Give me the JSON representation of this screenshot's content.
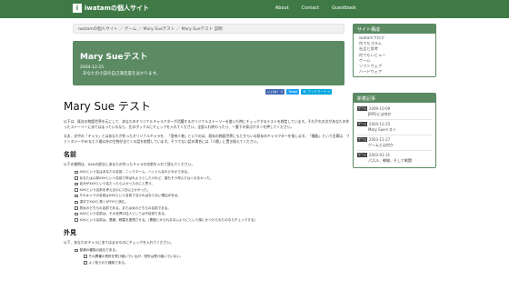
{
  "nav": {
    "logo_char": "i",
    "brand": "iwatamの個人サイト",
    "links": [
      "About",
      "Contact",
      "Guestbook"
    ]
  },
  "breadcrumb": "iwatamの個人サイト ／ ゲーム ／ Mary Sueテスト ／ Mary Sueテスト 説明",
  "hero": {
    "title": "Mary Sueテスト",
    "date": "2004-12-25",
    "subtitle": "あなたの小説の自己満足度をはかります。"
  },
  "share": {
    "like": "いいね！ 0",
    "tweet": "Tweet",
    "bookmark": "B! ブックマーク 0"
  },
  "article": {
    "title": "Mary Sue テスト",
    "p1": "以下は、既存の物語世界を元にして、あなたのオリジナルキャラクターが活躍するオリジナルストーリーを書いた時にチェックするテストを想定しています。それぞれの文があなたの作ったストーリーにあてはまっているなら、左のボックスにチェックを入れてください。全部入れ終わったら、一番下の採点ボタンを押してください。",
    "p2": "なお、文中の「キャラ」とはあなたが作ったオリジナルキャラを、「皇帝人物」というのは、既存の物語世界にもとからいる既存のキャラクターを指します。「種族」という言葉は、ファンタジーやSFなど人間以外の生物が出てくる話を前提しています。そうでない話の場合には「人間」に置き換えてください。",
    "sections": [
      {
        "heading": "名前",
        "intro": "以下の質問は、XXXの部分にあなたの作ったキャラの名前を入れて読んでください。",
        "items": [
          {
            "text": "XXXという名はあなたの名前、ニックネーム、ハンドル名のどれかである。",
            "sub": false
          },
          {
            "text": "あなたは以前XXXという名前で呼ばれようとしたけれど、誰もそう呼んではくれなかった。",
            "sub": false
          },
          {
            "text": "自分がXXXという名だったらよかったのにと思う。",
            "sub": false
          },
          {
            "text": "XXXという名前を考えるのに1日以上かかった。",
            "sub": false
          },
          {
            "text": "そのキャラの名前はXXXという名前でなければならない理由がある。",
            "sub": false
          },
          {
            "text": "漢字でXXXと書くがYYYと読む。",
            "sub": false
          },
          {
            "text": "男女のどちらの名前である。または女のどちらの名前である。",
            "sub": false
          },
          {
            "text": "XXXという名前は、その世界の住人としては不自然である。",
            "sub": false
          },
          {
            "text": "XXXという名前は、悪魔、精霊を連想させる。(悪魔とかられなないようにという風にかつけられたのならチェックする)",
            "sub": false
          }
        ]
      },
      {
        "heading": "外見",
        "intro": "以下、あなたのキャラにあてはまるものにチェックを入れてください。",
        "items": [
          {
            "text": "普通の種族の遺伝である。",
            "sub": false
          },
          {
            "text": "その異種の長所を受け継いでいるが、短所は受け継いでいない。",
            "sub": true
          },
          {
            "text": "よく知られた種族である。",
            "sub": true
          }
        ]
      }
    ]
  },
  "sidebar": {
    "site_links_title": "サイト構成",
    "site_links": [
      "iwatamブログ",
      "何でもコラム",
      "社会と思考",
      "何でもレビュー",
      "ゲーム",
      "ソフトウェア",
      "ハードウェア"
    ],
    "news_title": "新着記事",
    "news": [
      {
        "badge": "ゲーム",
        "date": "2009-10-09",
        "title": "JRPGとは何か"
      },
      {
        "badge": "ゲーム",
        "date": "2004-12-25",
        "title": "Mary Sueテスト"
      },
      {
        "badge": "ゲーム",
        "date": "2003-11-27",
        "title": "ゲームとは何か"
      },
      {
        "badge": "ゲーム",
        "date": "2003-01-31",
        "title": "パズル、戦略、そして戦闘"
      }
    ]
  },
  "colors": {
    "brand_green": "#3f7a46",
    "hero_green": "#5b8a63",
    "facebook": "#4267b2",
    "twitter": "#1da1f2",
    "hatena": "#00a4de"
  }
}
